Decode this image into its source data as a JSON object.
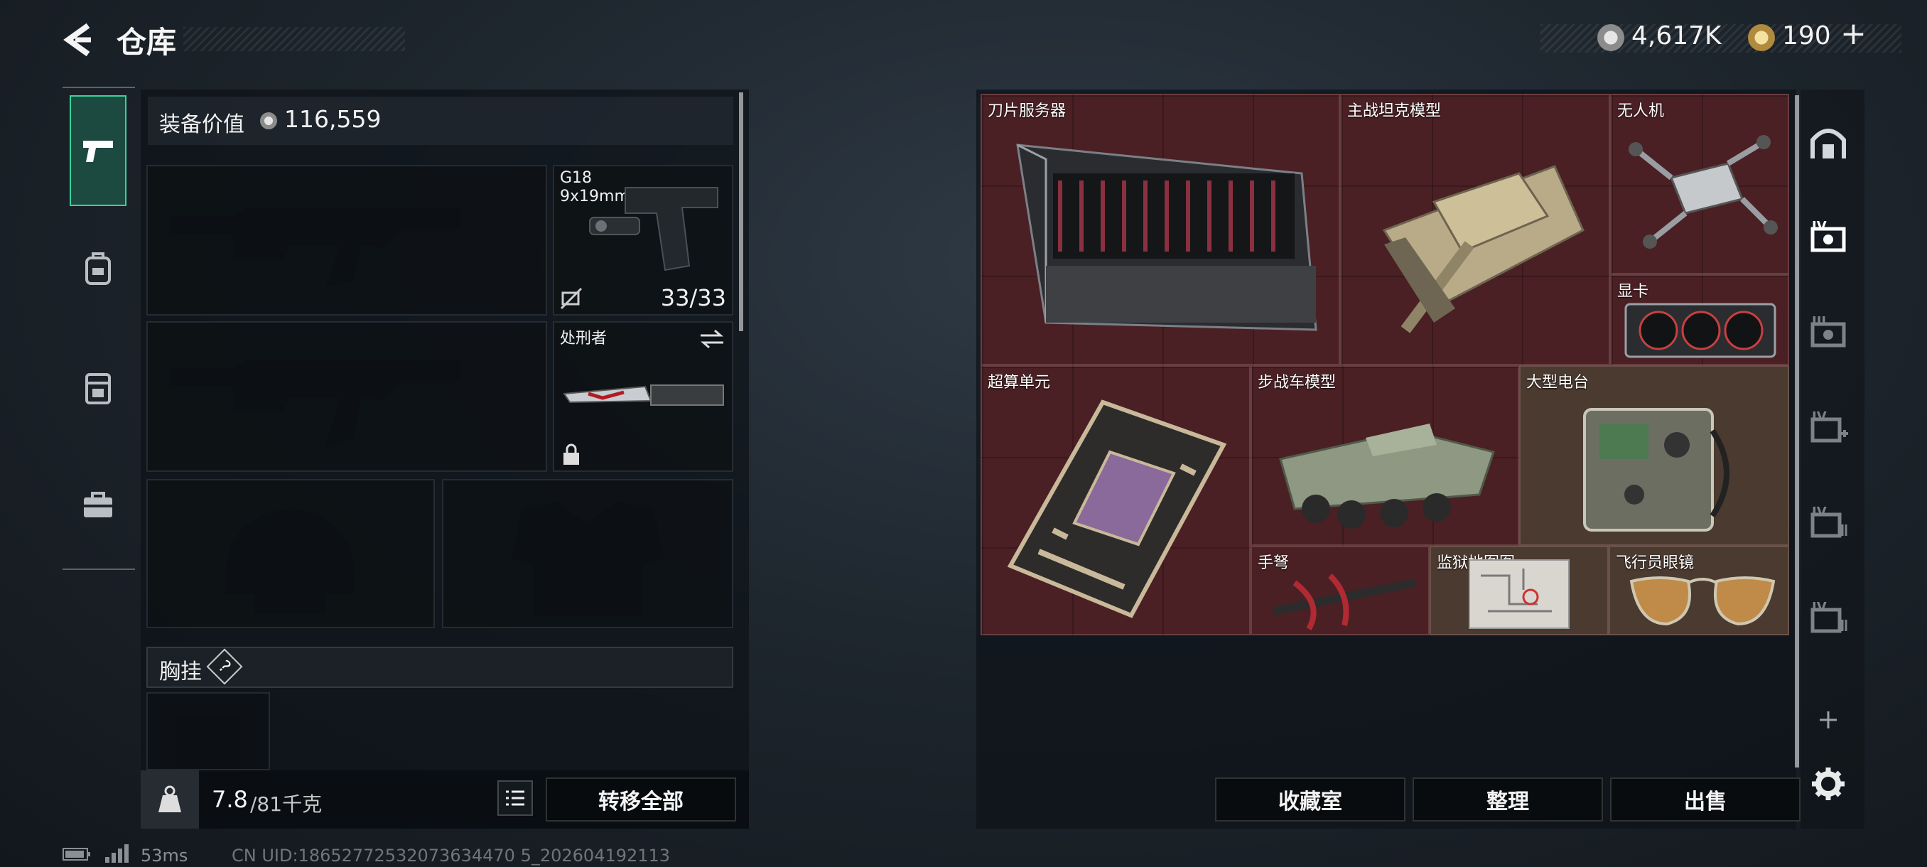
{
  "header": {
    "title": "仓库",
    "currency_main": "4,617K",
    "currency_second": "190",
    "plus_label": "+"
  },
  "equip": {
    "label": "装备价值",
    "value": "116,559"
  },
  "weapons": {
    "pistol": {
      "name": "G18",
      "caliber": "9x19mm",
      "ammo": "33/33"
    },
    "melee": {
      "name": "处刑者"
    }
  },
  "chest_rig": {
    "label": "胸挂",
    "help": "?"
  },
  "bottom_left": {
    "weight_current": "7.8",
    "weight_max": "/81千克",
    "transfer_label": "转移全部"
  },
  "status": {
    "ping": "53ms",
    "uid": "CN UID:18652772532073634470 5_202604192113"
  },
  "storage_items": [
    {
      "name": "刀片服务器",
      "icon": "blade-server"
    },
    {
      "name": "主战坦克模型",
      "icon": "tank-model"
    },
    {
      "name": "无人机",
      "icon": "drone"
    },
    {
      "name": "显卡",
      "icon": "graphics-card"
    },
    {
      "name": "超算单元",
      "icon": "supercomputer-unit"
    },
    {
      "name": "步战车模型",
      "icon": "ifv-model"
    },
    {
      "name": "大型电台",
      "icon": "radio-station"
    },
    {
      "name": "手弩",
      "icon": "hand-crossbow"
    },
    {
      "name": "监狱地图图",
      "icon": "prison-map"
    },
    {
      "name": "飞行员眼镜",
      "icon": "aviator-glasses"
    }
  ],
  "actions": {
    "collection": "收藏室",
    "organize": "整理",
    "sell": "出售"
  },
  "right_tabs": [
    "IV",
    "III",
    "IV",
    "IV",
    "IV"
  ],
  "colors": {
    "rare_bg": "#4a2024",
    "gold_bg": "#4b3a30",
    "accent": "#39d39a"
  }
}
